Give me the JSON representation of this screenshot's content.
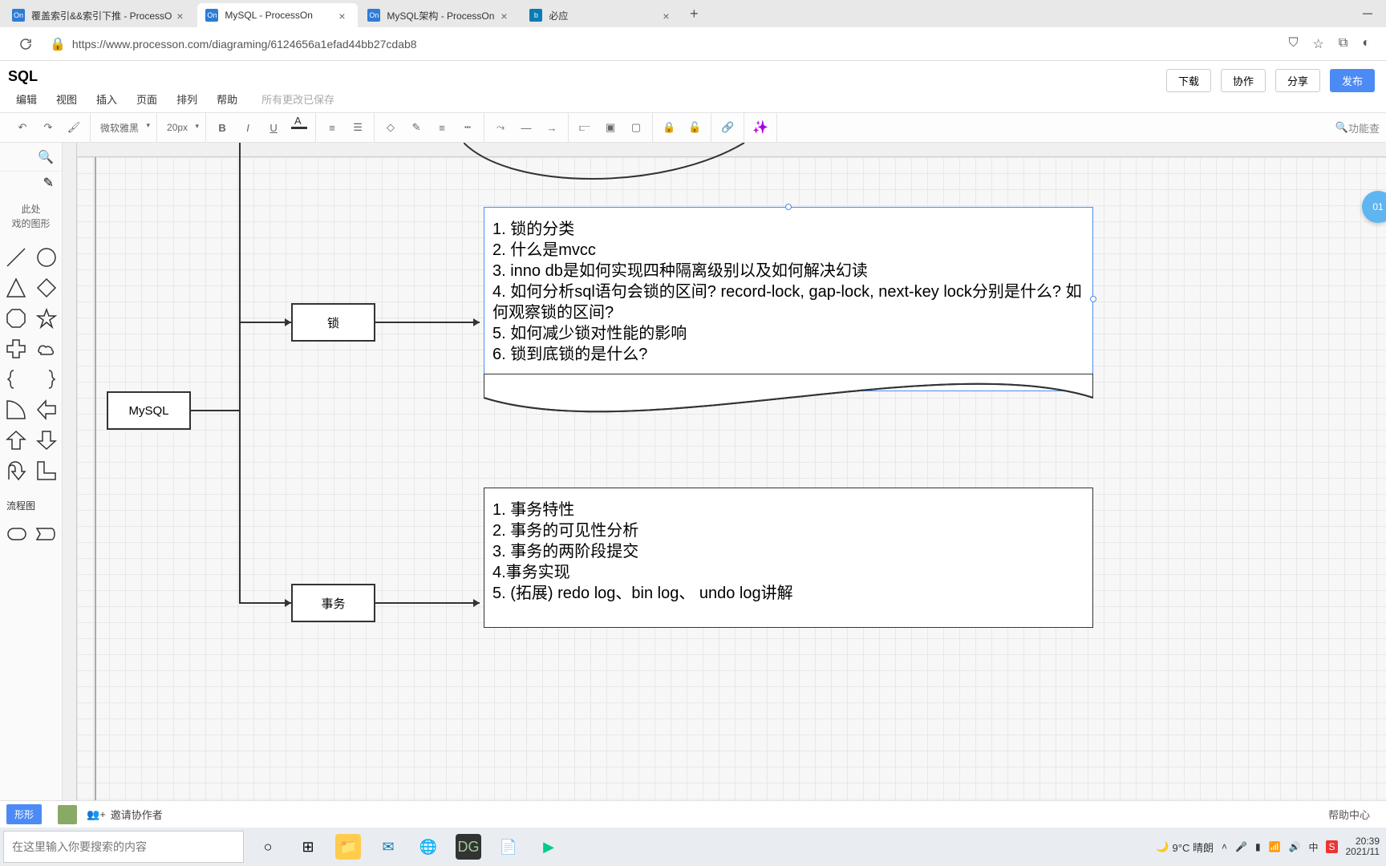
{
  "browser": {
    "tabs": [
      {
        "title": "覆盖索引&&索引下推 - ProcessO",
        "favicon": "On"
      },
      {
        "title": "MySQL - ProcessOn",
        "favicon": "On"
      },
      {
        "title": "MySQL架构 - ProcessOn",
        "favicon": "On"
      },
      {
        "title": "必应",
        "favicon": "b"
      }
    ],
    "url": "https://www.processon.com/diagraming/6124656a1efad44bb27cdab8"
  },
  "app": {
    "title": "SQL",
    "menus": [
      "编辑",
      "视图",
      "插入",
      "页面",
      "排列",
      "帮助"
    ],
    "save_status": "所有更改已保存",
    "actions": {
      "download": "下载",
      "collab": "协作",
      "share": "分享",
      "publish": "发布"
    }
  },
  "toolbar": {
    "font_family": "微软雅黑",
    "font_size": "20px",
    "search_label": "功能查"
  },
  "panel": {
    "myshapes_line1": "此处",
    "myshapes_line2": "戏的图形",
    "flowchart_label": "流程图",
    "shape_button": "形形"
  },
  "diagram": {
    "node_root": "MySQL",
    "node_lock": "锁",
    "node_tx": "事务",
    "box1": {
      "l1": "1. 锁的分类",
      "l2": "2. 什么是mvcc",
      "l3": "3. inno db是如何实现四种隔离级别以及如何解决幻读",
      "l4": "4. 如何分析sql语句会锁的区间? record-lock, gap-lock, next-key lock分别是什么? 如何观察锁的区间?",
      "l5": "5. 如何减少锁对性能的影响",
      "l6": "6. 锁到底锁的是什么?"
    },
    "box2": {
      "l1": "1. 事务特性",
      "l2": "2. 事务的可见性分析",
      "l3": "3. 事务的两阶段提交",
      "l4": "4.事务实现",
      "l5": "5. (拓展) redo log、bin log、 undo log讲解"
    },
    "badge": "01"
  },
  "collab": {
    "invite_label": "邀请协作者",
    "help_center": "帮助中心"
  },
  "taskbar": {
    "search_placeholder": "在这里输入你要搜索的内容",
    "weather_temp": "9°C 晴朗",
    "time": "20:39",
    "date": "2021/11"
  }
}
